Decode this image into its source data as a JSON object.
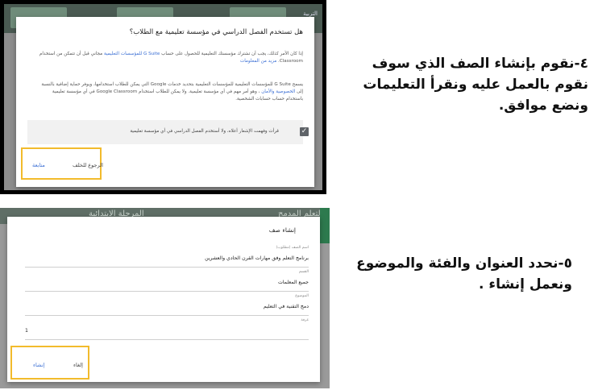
{
  "step1": {
    "background_label": "التربية",
    "dialog": {
      "title": "هل تستخدم الفصل الدراسي في مؤسسة تعليمية مع الطلاب؟",
      "para1_a": "إذا كان الأمر كذلك، يجب أن تشترك مؤسستك التعليمية للحصول على حساب",
      "para1_link": "G Suite للمؤسسات التعليمية",
      "para1_b": "مجاني قبل أن تتمكن من استخدام Classroom.",
      "para1_link2": "مزيد من المعلومات",
      "para2_a": "يسمح G Suite للمؤسسات التعليمية للمؤسسات التعليمية بتحديد خدمات Google التي يمكن للطلاب استخدامها، ويوفر حماية إضافية بالنسبة إلى",
      "para2_link": "الخصوصية والأمان",
      "para2_b": "، وهو أمر مهم في أي مؤسسة تعليمية. ولا يمكن للطلاب استخدام Google Classroom في أي مؤسسة تعليمية باستخدام حساب حسابات الشخصية.",
      "checkbox_text": "قرأت وفهمت الإشعار أعلاه، ولا أستخدم الفصل الدراسي في أي مؤسسة تعليمية",
      "back_button": "الرجوع للخلف",
      "continue_button": "متابعة"
    },
    "instruction": "٤-نقوم بإنشاء الصف الذي سوف نقوم بالعمل عليه ونقرأ التعليمات ونضع موافق."
  },
  "step2": {
    "background_label_left": "التعلم المدمج",
    "background_label_right": "المرحلة الابتدائية",
    "dialog": {
      "title": "إنشاء صف",
      "fields": [
        {
          "label": "اسم الصف (مطلوب)",
          "value": "برنامج التعلم وفق مهارات القرن الحادي والعشرين"
        },
        {
          "label": "القسم",
          "value": "جميع المعلمات"
        },
        {
          "label": "الموضوع",
          "value": "دمج التقنية في التعليم"
        },
        {
          "label": "غرفة",
          "value": "1"
        }
      ],
      "cancel_button": "إلغاء",
      "create_button": "إنشاء"
    },
    "instruction": "٥-نحدد العنوان والفئة والموضوع ونعمل إنشاء ."
  },
  "colors": {
    "highlight": "#f2bb2c",
    "link": "#3b6fd4",
    "checkbox": "#5f6368"
  }
}
